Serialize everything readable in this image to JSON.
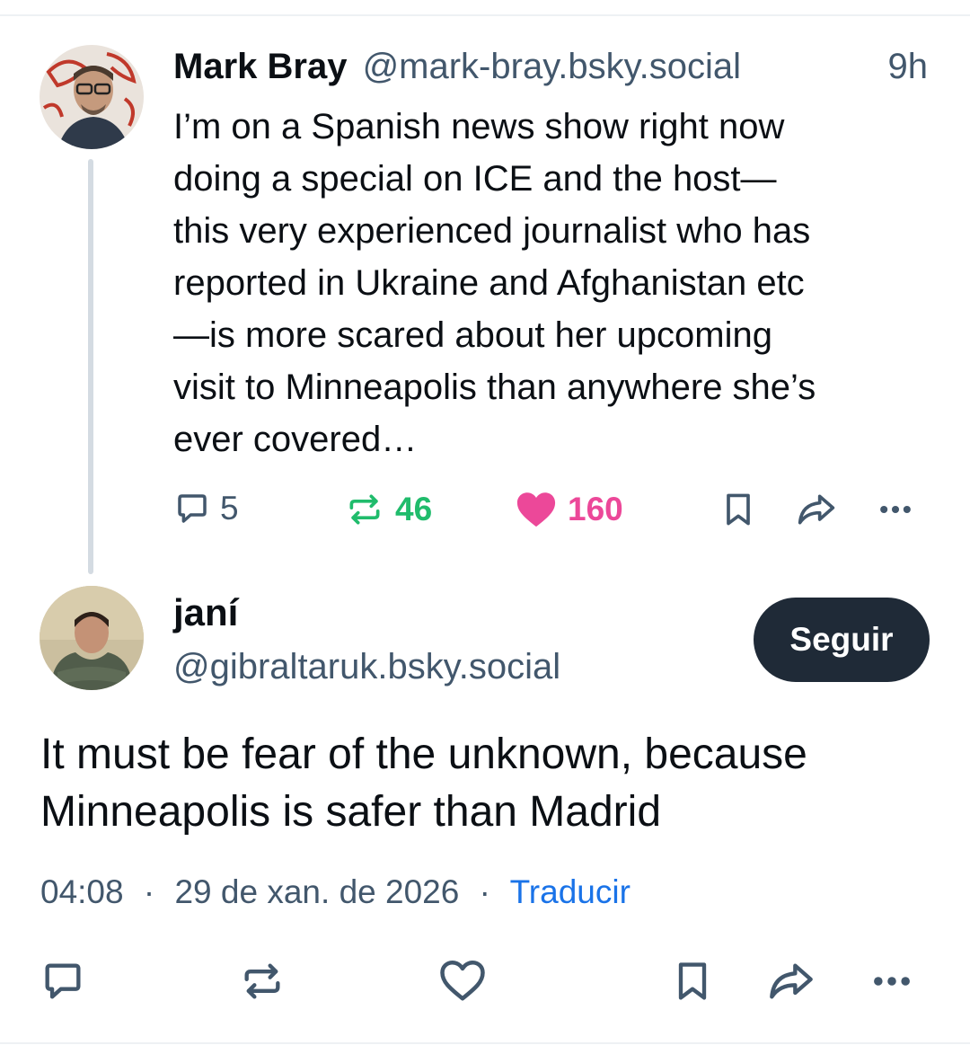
{
  "parent_post": {
    "author_name": "Mark Bray",
    "author_handle": "@mark-bray.bsky.social",
    "time_ago": "9h",
    "text": "I’m on a Spanish news show right now\ndoing a special on ICE and the host—\nthis very experienced journalist who has\nreported in Ukraine and Afghanistan etc\n—is more scared about her upcoming\nvisit to Minneapolis than anywhere she’s\never covered…",
    "reply_count": "5",
    "repost_count": "46",
    "like_count": "160",
    "icons": [
      "reply-icon",
      "repost-icon",
      "like-icon",
      "bookmark-icon",
      "share-icon",
      "more-icon"
    ],
    "repost_color": "#20bc6c",
    "like_color": "#ec4899"
  },
  "reply_post": {
    "author_name": "janí",
    "author_handle": "@gibraltaruk.bsky.social",
    "follow_label": "Seguir",
    "text": "It must be fear of the unknown, because Minneapolis is safer than Madrid",
    "time": "04:08",
    "date": "29 de xan. de 2026",
    "separator": "·",
    "translate_label": "Traducir",
    "icons": [
      "reply-icon",
      "repost-icon",
      "like-icon",
      "bookmark-icon",
      "share-icon",
      "more-icon"
    ],
    "translate_color": "#1a73e8"
  }
}
